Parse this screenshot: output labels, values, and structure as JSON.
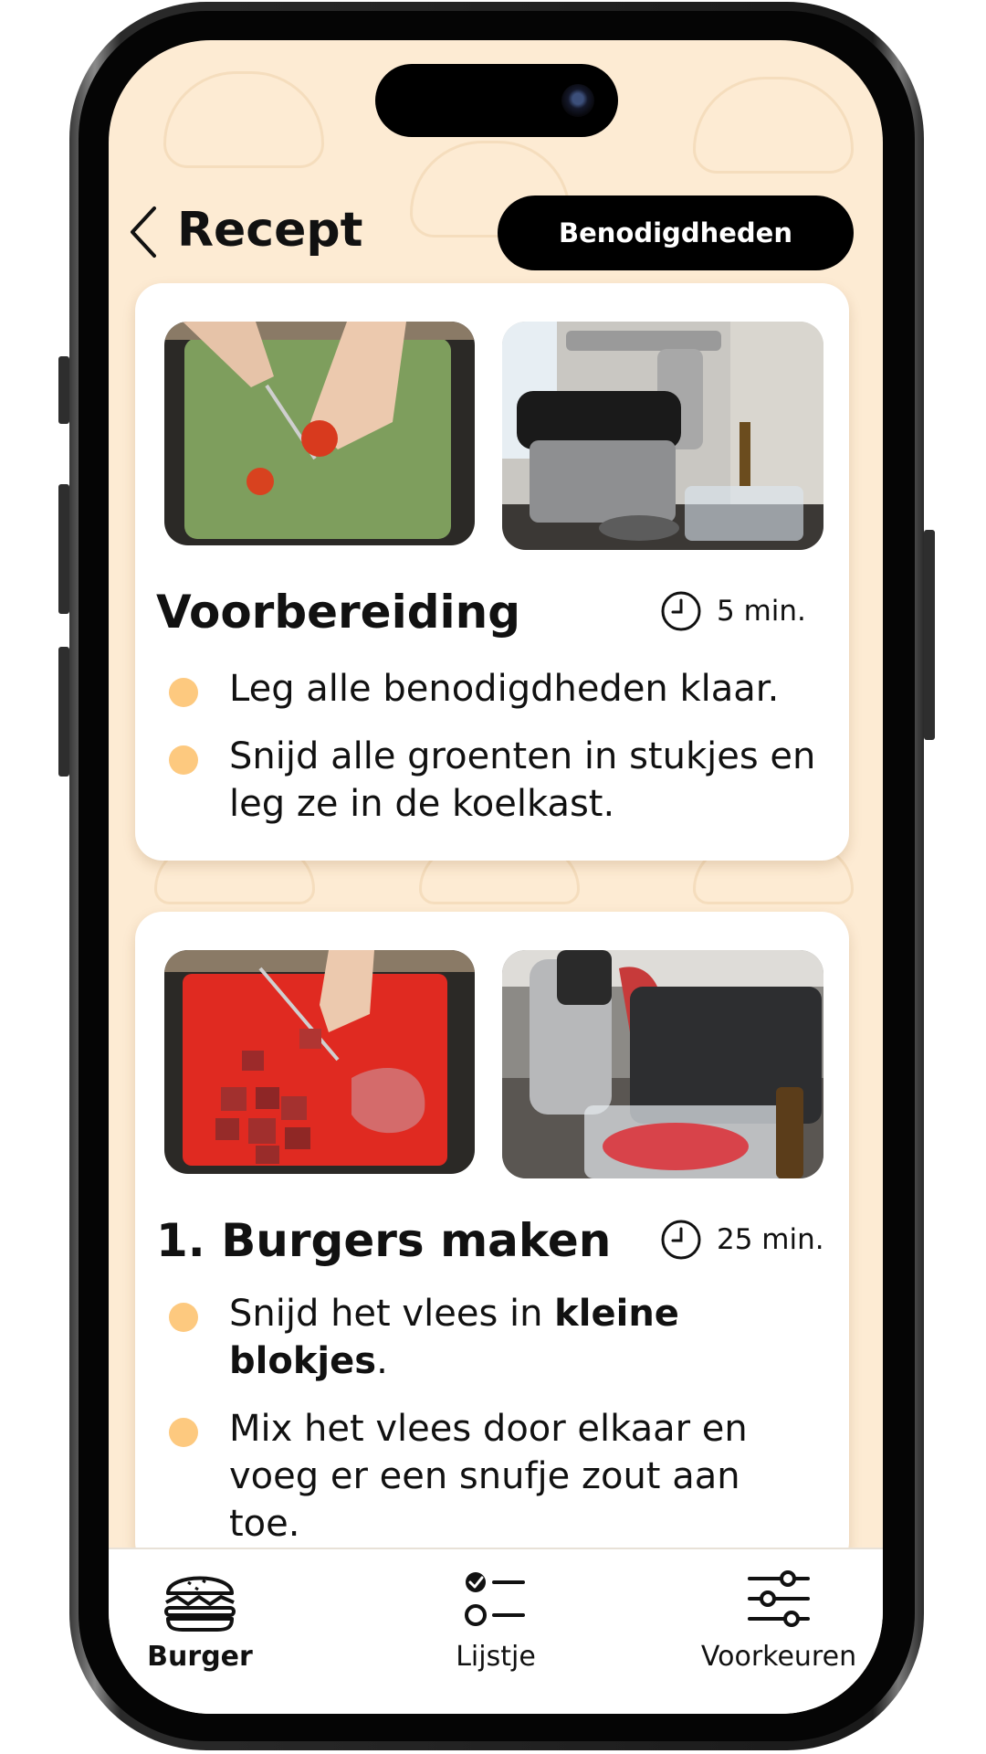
{
  "header": {
    "title": "Recept",
    "supplies_button": "Benodigdheden"
  },
  "cards": [
    {
      "title": "Voorbereiding",
      "time": "5 min.",
      "steps": [
        "Leg alle benodigdheden klaar.",
        "Snijd alle groenten in stukjes en leg ze in de koelkast."
      ]
    },
    {
      "title": "1. Burgers maken",
      "time": "25 min.",
      "step1_prefix": "Snijd het vlees in ",
      "step1_bold": "kleine blokjes",
      "step1_suffix": ".",
      "step2": "Mix het vlees door elkaar en voeg er een snufje zout aan toe."
    }
  ],
  "tabbar": {
    "tabs": [
      {
        "label": "Burger",
        "icon": "burger-icon",
        "active": true
      },
      {
        "label": "Lijstje",
        "icon": "checklist-icon",
        "active": false
      },
      {
        "label": "Voorkeuren",
        "icon": "sliders-icon",
        "active": false
      }
    ]
  },
  "colors": {
    "background": "#fdebd3",
    "bullet": "#fdc97f",
    "button": "#000000"
  }
}
